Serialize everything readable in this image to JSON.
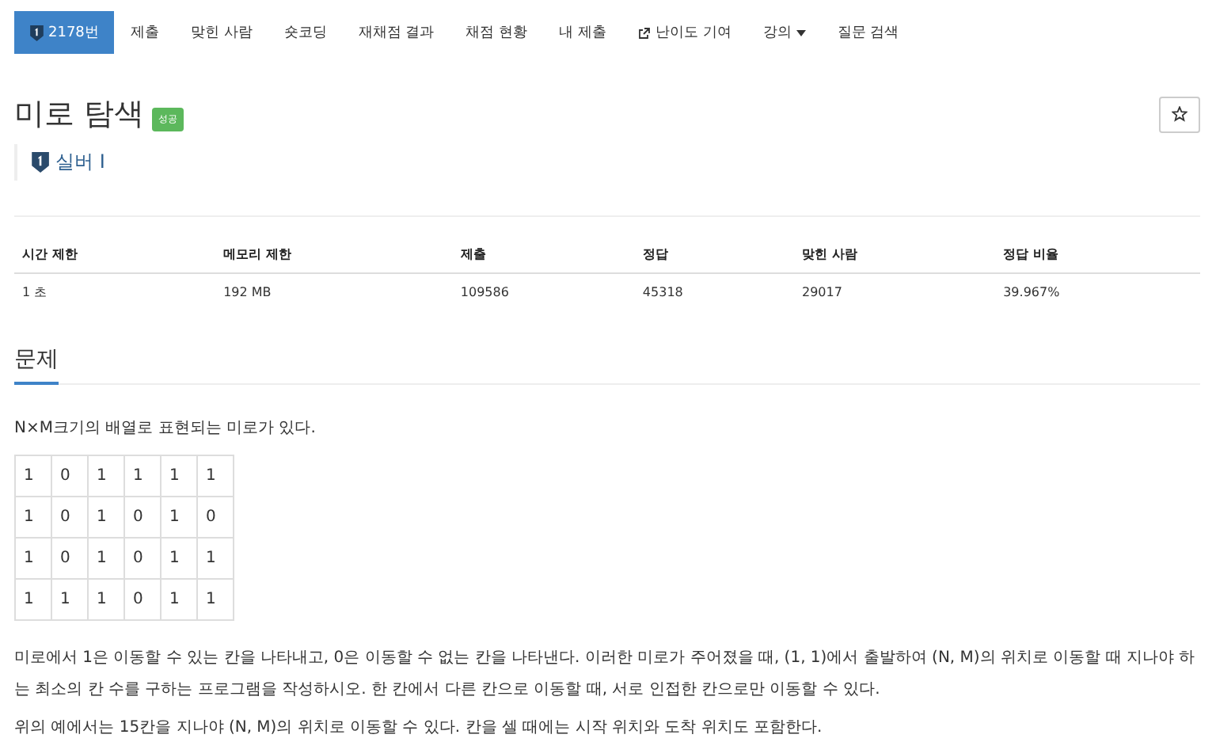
{
  "nav": [
    {
      "label": "2178번",
      "kind": "problem",
      "selected": true
    },
    {
      "label": "제출",
      "kind": "plain",
      "selected": false
    },
    {
      "label": "맞힌 사람",
      "kind": "plain",
      "selected": false
    },
    {
      "label": "숏코딩",
      "kind": "plain",
      "selected": false
    },
    {
      "label": "재채점 결과",
      "kind": "plain",
      "selected": false
    },
    {
      "label": "채점 현황",
      "kind": "plain",
      "selected": false
    },
    {
      "label": "내 제출",
      "kind": "plain",
      "selected": false
    },
    {
      "label": "난이도 기여",
      "kind": "external",
      "selected": false
    },
    {
      "label": "강의",
      "kind": "dropdown",
      "selected": false
    },
    {
      "label": "질문 검색",
      "kind": "plain",
      "selected": false
    }
  ],
  "title": "미로 탐색",
  "result_badge": "성공",
  "favorite": false,
  "tier": "실버 I",
  "info_table": {
    "columns": [
      "시간 제한",
      "메모리 제한",
      "제출",
      "정답",
      "맞힌 사람",
      "정답 비율"
    ],
    "rows": [
      [
        "1 초",
        "192 MB",
        "109586",
        "45318",
        "29017",
        "39.967%"
      ]
    ]
  },
  "section_heading": "문제",
  "intro": "N×M크기의 배열로 표현되는 미로가 있다.",
  "maze": [
    [
      "1",
      "0",
      "1",
      "1",
      "1",
      "1"
    ],
    [
      "1",
      "0",
      "1",
      "0",
      "1",
      "0"
    ],
    [
      "1",
      "0",
      "1",
      "0",
      "1",
      "1"
    ],
    [
      "1",
      "1",
      "1",
      "0",
      "1",
      "1"
    ]
  ],
  "paragraphs": [
    "미로에서 1은 이동할 수 있는 칸을 나타내고, 0은 이동할 수 없는 칸을 나타낸다. 이러한 미로가 주어졌을 때, (1, 1)에서 출발하여 (N, M)의 위치로 이동할 때 지나야 하는 최소의 칸 수를 구하는 프로그램을 작성하시오. 한 칸에서 다른 칸으로 이동할 때, 서로 인접한 칸으로만 이동할 수 있다.",
    "위의 예에서는 15칸을 지나야 (N, M)의 위치로 이동할 수 있다. 칸을 셀 때에는 시작 위치와 도착 위치도 포함한다."
  ]
}
